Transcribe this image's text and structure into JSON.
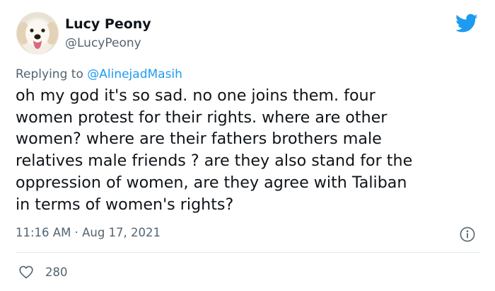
{
  "author": {
    "display_name": "Lucy Peony",
    "handle": "@LucyPeony",
    "avatar_icon": "dog-avatar"
  },
  "reply": {
    "prefix": "Replying to",
    "mention": "@AlinejadMasih"
  },
  "tweet": {
    "lines": [
      "oh my god it's so sad. no one joins them. four",
      "women protest for their rights. where are other",
      "women? where are their fathers brothers male",
      "relatives male friends ? are they also stand for the",
      "oppression of women, are they agree with Taliban",
      "in terms of women's rights?"
    ]
  },
  "meta": {
    "time": "11:16 AM",
    "separator": "·",
    "date": "Aug 17, 2021"
  },
  "actions": {
    "like_count": "280",
    "like_icon": "heart-icon",
    "info_icon": "info-icon"
  },
  "brand": {
    "logo_icon": "twitter-bird-icon",
    "accent_color": "#1d9bf0",
    "secondary_text_color": "#536471",
    "primary_text_color": "#0f1419"
  }
}
